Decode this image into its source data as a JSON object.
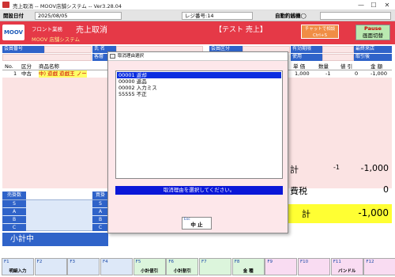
{
  "window": {
    "title": "売上取消 -- MOOV店舗システム -- Ver3.28.04",
    "minimize": "—",
    "maximize": "☐",
    "close": "✕"
  },
  "infobar": {
    "open_date_label": "開設日付",
    "open_date": "2025/08/05",
    "register_no_label": "レジ番号:14",
    "auto_reload": "自動釣銭機◯"
  },
  "header": {
    "logo": "MOOV",
    "section": "フロント業務",
    "screen_title": "売上取消",
    "system_name": "MOOV 店舗システム",
    "test_badge": "【テスト 売上】",
    "chat_button": "チャットで相談",
    "chat_shortcut": "Ctrl+S",
    "pause_button": "Pause",
    "pause_sub": "画面切替"
  },
  "member": {
    "member_no_label": "会員番号",
    "name_label": "氏 名",
    "customer_label": "客層",
    "member_type_label": "会員区分",
    "valid_until_label": "有効期限",
    "usage_label": "使用",
    "last_visit_label": "最終来店",
    "purchase_label": "取引後"
  },
  "table": {
    "headers": [
      "No.",
      "区分",
      "商品名称",
      "単 価",
      "数量",
      "値 引",
      "金 額"
    ],
    "rows": [
      {
        "no": "1",
        "kubun": "中古",
        "name": "中) 遊戯  遊戯王  ノー",
        "price": "1,000",
        "qty": "-1",
        "discount": "0",
        "amount": "-1,000"
      }
    ]
  },
  "summary": {
    "subtotal_label": "計",
    "subtotal_qty": "-1",
    "subtotal_amount": "-1,000",
    "tax_label": "費税",
    "tax_amount": "0",
    "total_label": "計",
    "total_amount": "-1,000"
  },
  "grid": {
    "sell_label": "売掛数",
    "buy_label": "買掛",
    "ranks": [
      "S",
      "A",
      "B",
      "C"
    ],
    "subtotal_mid": "小計中"
  },
  "fkeys": [
    {
      "key": "F1",
      "label": "明細入力",
      "color": "#dde8f8"
    },
    {
      "key": "F2",
      "label": "",
      "color": "#dde8f8"
    },
    {
      "key": "F3",
      "label": "",
      "color": "#dde8f8"
    },
    {
      "key": "F4",
      "label": "",
      "color": "#dde8f8"
    },
    {
      "key": "F5",
      "label": "小計値引",
      "color": "#dcf5dc"
    },
    {
      "key": "F6",
      "label": "小計割引",
      "color": "#dcf5dc"
    },
    {
      "key": "F7",
      "label": "",
      "color": "#dcf5dc"
    },
    {
      "key": "F8",
      "label": "金 種",
      "color": "#dcf5dc"
    },
    {
      "key": "F9",
      "label": "",
      "color": "#f9dcf2"
    },
    {
      "key": "F10",
      "label": "",
      "color": "#f9dcf2"
    },
    {
      "key": "F11",
      "label": "バンドル",
      "color": "#f9dcf2"
    },
    {
      "key": "F12",
      "label": "",
      "color": "#f9dcf2"
    }
  ],
  "dialog": {
    "title": "取消理由選択",
    "options": [
      {
        "code": "00001",
        "label": "返却",
        "selected": true
      },
      {
        "code": "00000",
        "label": "返品",
        "selected": false
      },
      {
        "code": "00002",
        "label": "入力ミス",
        "selected": false
      },
      {
        "code": "55555",
        "label": "不正",
        "selected": false
      }
    ],
    "message": "取消理由を選択してください。",
    "cancel_key": "Esc",
    "cancel_label": "中 止"
  },
  "colors": {
    "header_red": "#e53947",
    "label_blue": "#2f63c9",
    "selection_blue": "#0a2ee0",
    "total_yellow": "#ffff33"
  }
}
